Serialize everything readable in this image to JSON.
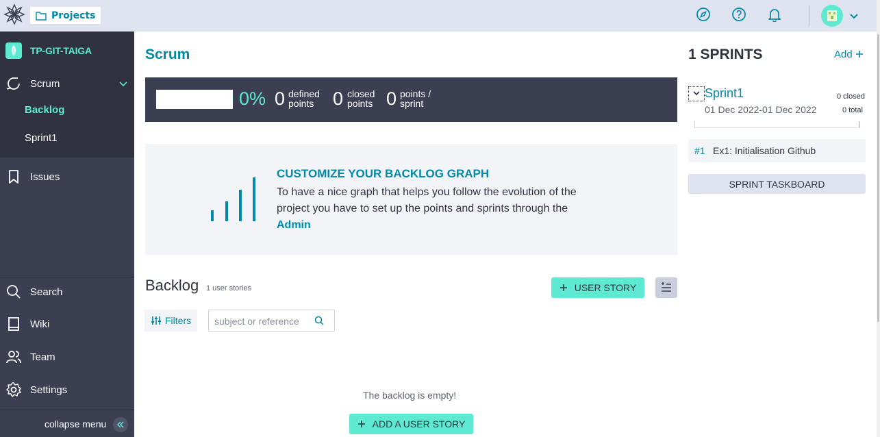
{
  "topbar": {
    "projects_label": "Projects",
    "icons": [
      "taiga-logo-icon",
      "folder-icon",
      "compass-icon",
      "help-icon",
      "bell-icon",
      "avatar",
      "chevron-down-icon"
    ]
  },
  "sidebar": {
    "project_name": "TP-GIT-TAIGA",
    "scrum_label": "Scrum",
    "backlog_label": "Backlog",
    "sprint1_label": "Sprint1",
    "issues_label": "Issues",
    "search_label": "Search",
    "wiki_label": "Wiki",
    "team_label": "Team",
    "settings_label": "Settings",
    "collapse_label": "collapse menu",
    "accent": "#5ee9d3"
  },
  "main": {
    "title": "Scrum",
    "summary": {
      "percent": "0%",
      "progress_fraction": 0,
      "defined_value": "0",
      "defined_l1": "defined",
      "defined_l2": "points",
      "closed_value": "0",
      "closed_l1": "closed",
      "closed_l2": "points",
      "sprint_value": "0",
      "sprint_l1": "points /",
      "sprint_l2": "sprint"
    },
    "graph": {
      "title": "CUSTOMIZE YOUR BACKLOG GRAPH",
      "text": "To have a nice graph that helps you follow the evolution of the project you have to set up the points and sprints through the",
      "link": "Admin"
    },
    "backlog": {
      "title": "Backlog",
      "count": "1 user stories",
      "user_story_button": "USER STORY",
      "filters_label": "Filters",
      "search_placeholder": "subject or reference",
      "empty_text": "The backlog is empty!",
      "add_button": "ADD A USER STORY"
    }
  },
  "sprints_panel": {
    "title": "1 SPRINTS",
    "add_label": "Add",
    "sprint": {
      "name": "Sprint1",
      "dates": "01 Dec 2022-01 Dec 2022",
      "closed": "0 closed",
      "total": "0 total",
      "item_ref": "#1",
      "item_subject": "Ex1: Initialisation Github"
    },
    "taskboard_button": "SPRINT TASKBOARD"
  },
  "colors": {
    "brand": "#008aa8",
    "accent": "#5ee9d3",
    "sidebar_bg": "#3c3e52",
    "topbar_bg": "#dfe3f0"
  }
}
